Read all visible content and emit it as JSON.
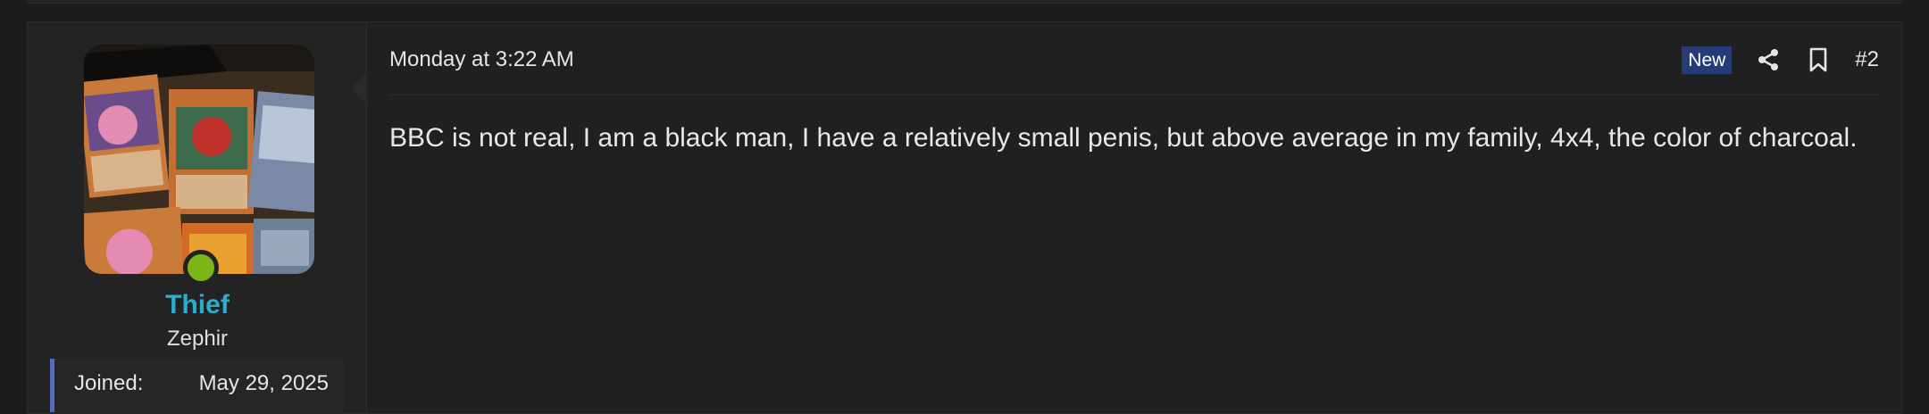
{
  "post": {
    "author": {
      "username": "Thief",
      "user_title": "Zephir",
      "online": true,
      "extras": [
        {
          "label": "Joined:",
          "value": "May 29, 2025"
        }
      ]
    },
    "date": "Monday at 3:22 AM",
    "badge": "New",
    "number": "#2",
    "body": "BBC is not real, I am a black man, I have a relatively small penis, but above average in my family, 4x4, the color of charcoal.",
    "actions": {
      "share_icon": "share-icon",
      "bookmark_icon": "bookmark-icon"
    }
  },
  "colors": {
    "username": "#2aaed0",
    "online": "#7cb518",
    "badge_bg": "#273a78",
    "extras_border": "#5a6cb0"
  }
}
